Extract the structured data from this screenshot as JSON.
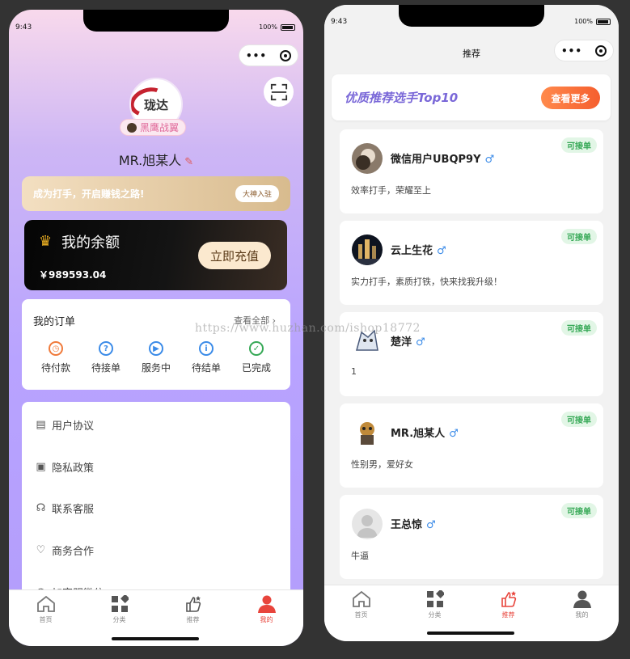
{
  "left": {
    "status": {
      "time": "9:43",
      "battery": "100%"
    },
    "capsule": {
      "more": "•••"
    },
    "avatar_text": "珑达",
    "tag": "黑鹰战翼",
    "username": "MR.旭某人",
    "promo": {
      "text": "成为打手，开启赚钱之路!",
      "button": "大神入驻"
    },
    "balance": {
      "title": "我的余额",
      "amount": "￥989593.04",
      "button": "立即充值"
    },
    "orders": {
      "title": "我的订单",
      "view_all": "查看全部",
      "items": [
        {
          "label": "待付款",
          "icon": "clock-icon",
          "color": "#f07a3a"
        },
        {
          "label": "待接单",
          "icon": "question-icon",
          "color": "#3b8be8"
        },
        {
          "label": "服务中",
          "icon": "play-icon",
          "color": "#3b8be8"
        },
        {
          "label": "待结单",
          "icon": "info-icon",
          "color": "#3b8be8"
        },
        {
          "label": "已完成",
          "icon": "check-icon",
          "color": "#35a855"
        }
      ]
    },
    "menu": [
      {
        "label": "用户协议",
        "icon": "document-icon"
      },
      {
        "label": "隐私政策",
        "icon": "privacy-icon"
      },
      {
        "label": "联系客服",
        "icon": "headset-icon"
      },
      {
        "label": "商务合作",
        "icon": "heart-icon"
      },
      {
        "label": "加客服微信",
        "icon": "wechat-icon"
      }
    ],
    "tabs": [
      {
        "label": "首页"
      },
      {
        "label": "分类"
      },
      {
        "label": "推荐"
      },
      {
        "label": "我的"
      }
    ]
  },
  "right": {
    "status": {
      "time": "9:43",
      "battery": "100%"
    },
    "capsule": {
      "more": "•••"
    },
    "nav_title": "推荐",
    "banner": {
      "text": "优质推荐选手Top10",
      "button": "查看更多"
    },
    "players": [
      {
        "name": "微信用户UBQP9Y",
        "gender": "♂",
        "badge": "可接单",
        "desc": "效率打手，荣耀至上"
      },
      {
        "name": "云上生花",
        "gender": "♂",
        "badge": "可接单",
        "desc": "实力打手，素质打铁，快来找我升级！"
      },
      {
        "name": "楚洋",
        "gender": "♂",
        "badge": "可接单",
        "desc": "1"
      },
      {
        "name": "MR.旭某人",
        "gender": "♂",
        "badge": "可接单",
        "desc": "性别男，爱好女"
      },
      {
        "name": "王总惊",
        "gender": "♂",
        "badge": "可接单",
        "desc": "牛逼"
      }
    ],
    "tabs": [
      {
        "label": "首页"
      },
      {
        "label": "分类"
      },
      {
        "label": "推荐"
      },
      {
        "label": "我的"
      }
    ]
  },
  "watermark": "https://www.huzhan.com/ishop18772",
  "colors": {
    "accent_red": "#e8453c",
    "badge_green": "#35a855",
    "banner_purple": "#7a68d8"
  }
}
